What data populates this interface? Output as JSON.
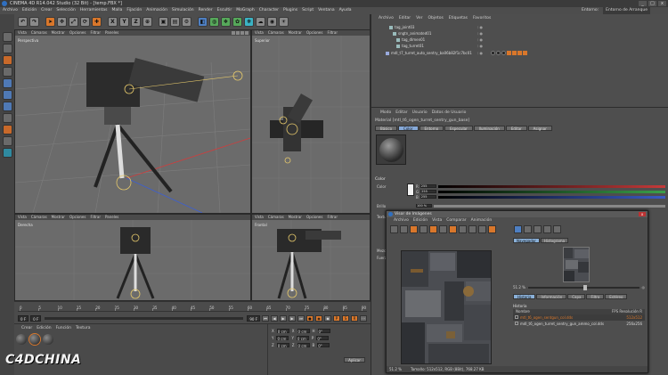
{
  "window": {
    "title": "CINEMA 4D R14.042 Studio (32 Bit) - [temp.FBX *]",
    "buttons": [
      "_",
      "□",
      "x"
    ]
  },
  "menu_main": [
    "Archivo",
    "Edición",
    "Crear",
    "Selección",
    "Herramientas",
    "Malla",
    "Fijación",
    "Animación",
    "Simulación",
    "Render",
    "Escultir",
    "MoGraph",
    "Character",
    "Plugins",
    "Script",
    "Ventana",
    "Ayuda"
  ],
  "menu_right": {
    "items": [
      "Entorno:",
      "Entorno de Arranque"
    ]
  },
  "toolbar": {
    "x_label": "X",
    "y_label": "Y",
    "z_label": "Z"
  },
  "viewports": {
    "menu": [
      "Vista",
      "Cámaras",
      "Mostrar",
      "Opciones",
      "Filtrar",
      "Paneles"
    ],
    "perspective": "Perspectiva",
    "top": "Superior",
    "right": "Derecha",
    "front": "Frontal"
  },
  "timeline": {
    "ticks": [
      "0",
      "5",
      "10",
      "15",
      "20",
      "25",
      "30",
      "35",
      "40",
      "45",
      "50",
      "55",
      "60",
      "65",
      "70",
      "75",
      "80",
      "85",
      "90"
    ],
    "start_field": "0 F",
    "end_field": "90 F",
    "current_field": "0 F",
    "end_marker": "0 F"
  },
  "materials": {
    "menu": [
      "Crear",
      "Edición",
      "Función",
      "Textura"
    ],
    "count": 3
  },
  "coordinates": {
    "rows": [
      {
        "a": "X",
        "b": "0 cm",
        "c": "X",
        "d": "0 cm",
        "e": "H",
        "f": "0°"
      },
      {
        "a": "Y",
        "b": "0 cm",
        "c": "Y",
        "d": "0 cm",
        "e": "P",
        "f": "0°"
      },
      {
        "a": "Z",
        "b": "0 cm",
        "c": "Z",
        "d": "0 cm",
        "e": "B",
        "f": "0°"
      }
    ],
    "apply": "Aplicar"
  },
  "object_manager": {
    "menu": [
      "Archivo",
      "Editar",
      "Ver",
      "Objetos",
      "Etiquetas",
      "Favoritos"
    ],
    "rows": [
      {
        "name": "tag_joint03",
        "indent": 1
      },
      {
        "name": "sngtn_animated01",
        "indent": 2
      },
      {
        "name": "tag_dlmen01",
        "indent": 3
      },
      {
        "name": "tag_turret01",
        "indent": 3
      },
      {
        "name": "mdl_t7_turret_auto_sentry_ba06b82f1c7bc01",
        "indent": 0
      }
    ]
  },
  "attributes": {
    "menu": [
      "Modo",
      "Editar",
      "Usuario",
      "Datos de Usuario"
    ],
    "name": "Material [mtl_t6_ogen_turret_sentry_gun_base]",
    "tabs": [
      {
        "label": "Básico",
        "on": false
      },
      {
        "label": "Color",
        "on": true
      },
      {
        "label": "Entorno",
        "on": false
      },
      {
        "label": "Especular",
        "on": false
      },
      {
        "label": "Iluminación",
        "on": false
      },
      {
        "label": "Editar",
        "on": false
      },
      {
        "label": "Asignar",
        "on": false
      }
    ],
    "section_title": "Color",
    "color_label": "Color",
    "brillo_label": "Brillo",
    "textura_label": "Textura",
    "mezcla_label": "Mezcla",
    "fuerza_label": "Fuerza",
    "rgb": [
      {
        "ch": "R",
        "value": "255",
        "color": "#c53a3a"
      },
      {
        "ch": "G",
        "value": "255",
        "color": "#3aa04a"
      },
      {
        "ch": "B",
        "value": "255",
        "color": "#3a5ac5"
      }
    ],
    "brillo_value": "100 %"
  },
  "image_viewer": {
    "title": "Visor de Imágenes",
    "menu": [
      "Archivo",
      "Edición",
      "Vista",
      "Comparar",
      "Animación"
    ],
    "tabs": [
      {
        "label": "Navegador",
        "on": true
      },
      {
        "label": "Histograma",
        "on": false
      }
    ],
    "zoom": "51.2 %",
    "hist_tabs": [
      {
        "label": "Historia",
        "on": true
      },
      {
        "label": "Información",
        "on": false
      },
      {
        "label": "Capa",
        "on": false
      },
      {
        "label": "Filtro",
        "on": false
      },
      {
        "label": "Estéreo",
        "on": false
      }
    ],
    "history_title": "Historia",
    "columns": {
      "name": "Nombre",
      "res": "FPS  Resolución  R"
    },
    "entries": [
      {
        "name": "mtl_t6_ogen_sentgun_col.dds",
        "res": "512x512",
        "sel": true
      },
      {
        "name": "mdl_t6_ogen_turret_sentry_gun_ammo_col.dds",
        "res": "256x256",
        "sel": false
      }
    ],
    "status_zoom": "51.2 %",
    "status_info": "Tamaño: 512x512, RGB (8Bit), 768.27 KB"
  },
  "watermark": "C4DCHINA",
  "colors": {
    "accent": "#d9772b",
    "selection_blue": "#86a9d8"
  }
}
